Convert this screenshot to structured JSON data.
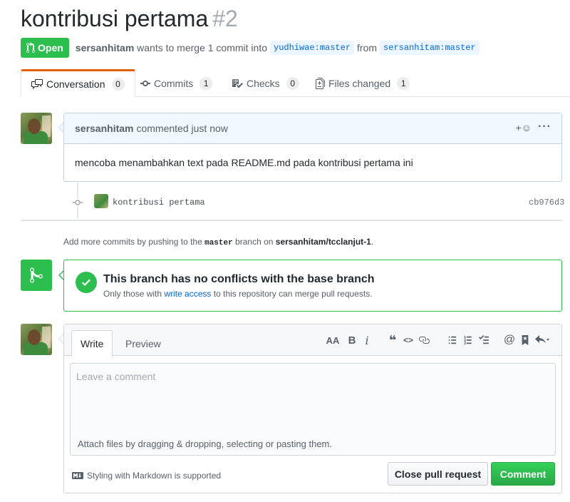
{
  "pr": {
    "title": "kontribusi pertama",
    "number": "#2",
    "state": "Open",
    "author": "sersanhitam",
    "merge_text": "wants to merge 1 commit into",
    "base_branch": "yudhiwae:master",
    "from_text": "from",
    "head_branch": "sersanhitam:master"
  },
  "tabs": [
    {
      "label": "Conversation",
      "count": "0"
    },
    {
      "label": "Commits",
      "count": "1"
    },
    {
      "label": "Checks",
      "count": "0"
    },
    {
      "label": "Files changed",
      "count": "1"
    }
  ],
  "comment": {
    "author": "sersanhitam",
    "action": "commented just now",
    "reaction_label": "+☺",
    "more_label": "···",
    "body": "mencoba menambahkan text pada README.md pada kontribusi pertama ini"
  },
  "commit": {
    "message": "kontribusi pertama",
    "sha": "cb976d3"
  },
  "add_commits": {
    "prefix": "Add more commits by pushing to the",
    "branch": "master",
    "middle": "branch on",
    "repo": "sersanhitam/tcclanjut-1",
    "suffix": "."
  },
  "merge": {
    "title": "This branch has no conflicts with the base branch",
    "sub_prefix": "Only those with",
    "sub_link": "write access",
    "sub_suffix": "to this repository can merge pull requests."
  },
  "new_comment": {
    "tab_write": "Write",
    "tab_preview": "Preview",
    "placeholder": "Leave a comment",
    "attach": "Attach files by dragging & dropping, selecting or pasting them.",
    "markdown_note": "Styling with Markdown is supported",
    "close_button": "Close pull request",
    "comment_button": "Comment",
    "toolbar": {
      "header": "AA",
      "bold": "B",
      "italic": "i",
      "quote": "❝",
      "code": "<>",
      "at": "@"
    }
  },
  "colors": {
    "green": "#2cbe4e",
    "link": "#0366d6",
    "tab_accent": "#e36209"
  }
}
